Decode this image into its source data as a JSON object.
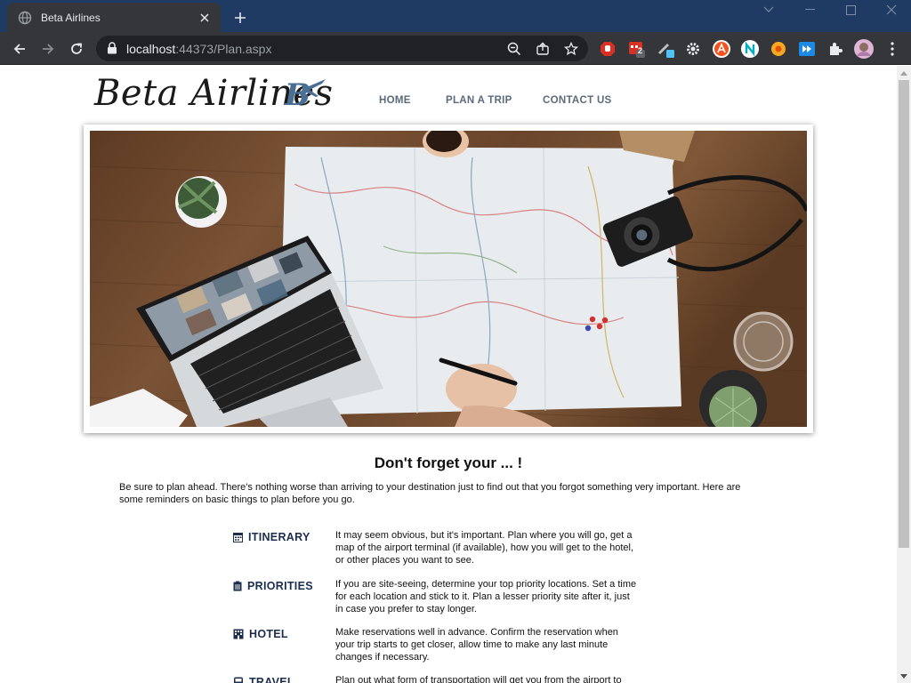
{
  "browser": {
    "tab_title": "Beta Airlines",
    "url_host": "localhost",
    "url_rest": ":44373/Plan.aspx",
    "extension_badge": "2"
  },
  "site": {
    "logo_text": "Beta Airlines",
    "nav": [
      "HOME",
      "PLAN A TRIP",
      "CONTACT US"
    ]
  },
  "content": {
    "heading": "Don't forget your ... !",
    "intro": "Be sure to plan ahead. There's nothing worse than arriving to your destination just to find out that you forgot something very important. Here are some reminders on basic things to plan before you go.",
    "items": [
      {
        "icon": "calendar-icon",
        "label": "ITINERARY",
        "text": "It may seem obvious, but it's important. Plan where you will go, get a map of the airport terminal (if available), how you will get to the hotel, or other places you want to see."
      },
      {
        "icon": "clipboard-icon",
        "label": "PRIORITIES",
        "text": "If you are site-seeing, determine your top priority locations. Set a time for each location and stick to it. Plan a lesser priority site after it, just in case you prefer to stay longer."
      },
      {
        "icon": "hotel-icon",
        "label": "HOTEL",
        "text": "Make reservations well in advance. Confirm the reservation when your trip starts to get closer, allow time to make any last minute changes if necessary."
      },
      {
        "icon": "bus-icon",
        "label": "TRAVEL",
        "text": "Plan out what form of transportation will get you from the airport to your"
      }
    ]
  },
  "colors": {
    "titlebar": "#1f3b63",
    "toolbar": "#35363a",
    "nav_text": "#5a6b7b",
    "label_text": "#1c2e4d"
  }
}
